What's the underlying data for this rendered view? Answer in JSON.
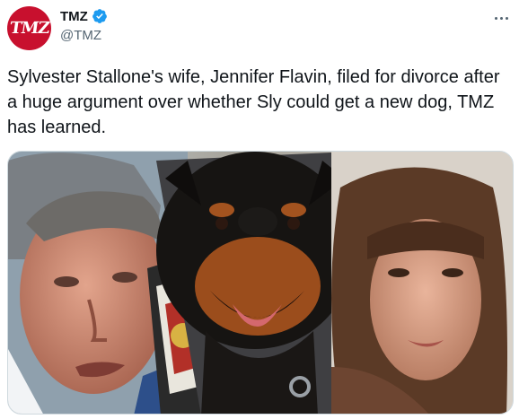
{
  "author": {
    "name": "TMZ",
    "handle": "@TMZ",
    "avatar_text": "TMZ",
    "verified": true,
    "avatar_color": "#c8102e",
    "verified_color": "#1d9bf0"
  },
  "tweet": {
    "text": "Sylvester Stallone's wife, Jennifer Flavin, filed for divorce after a huge argument over whether Sly could get a new dog, TMZ has learned."
  },
  "icons": {
    "more": "more-dots-icon",
    "verified": "verified-badge-icon"
  }
}
